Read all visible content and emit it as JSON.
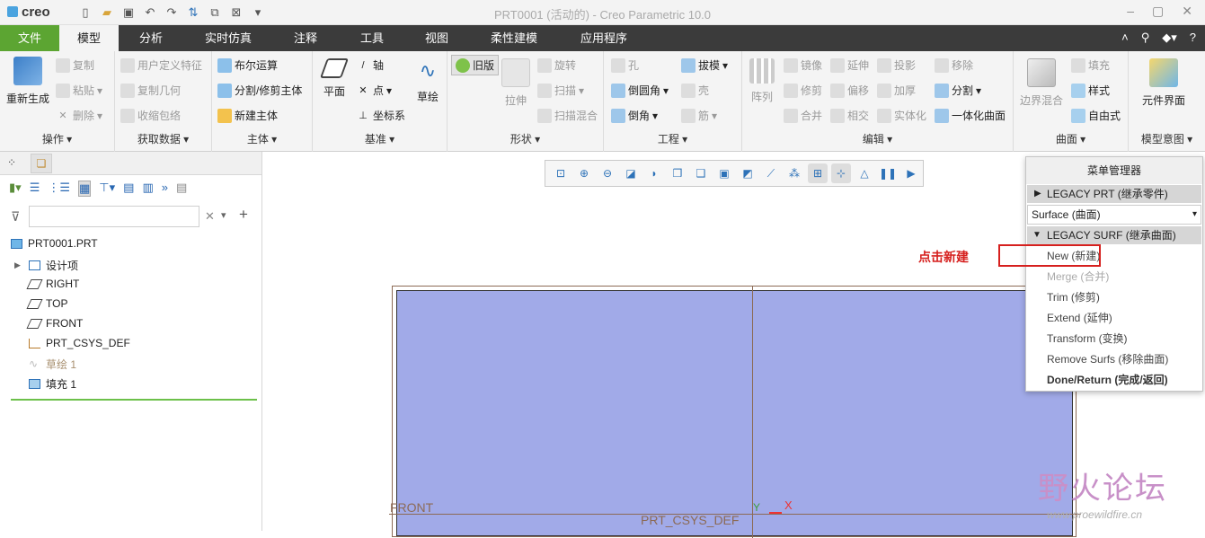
{
  "app": {
    "logo": "creo",
    "window_title": "PRT0001 (活动的) - Creo Parametric 10.0"
  },
  "tabs": {
    "file": "文件",
    "items": [
      "模型",
      "分析",
      "实时仿真",
      "注释",
      "工具",
      "视图",
      "柔性建模",
      "应用程序"
    ]
  },
  "ribbon": {
    "ops": {
      "regen": "重新生成",
      "copy": "复制",
      "paste": "粘贴",
      "delete": "删除",
      "name": "操作"
    },
    "getdata": {
      "udf": "用户定义特征",
      "copygeom": "复制几何",
      "shrinkwrap": "收缩包络",
      "name": "获取数据"
    },
    "body": {
      "boolean": "布尔运算",
      "split": "分割/修剪主体",
      "newbody": "新建主体",
      "name": "主体"
    },
    "datum": {
      "plane": "平面",
      "axis": "轴",
      "point": "点",
      "csys": "坐标系",
      "sketch": "草绘",
      "name": "基准"
    },
    "shapes": {
      "legacy": "旧版",
      "extrude": "拉伸",
      "revolve": "旋转",
      "sweep": "扫描",
      "sweepblend": "扫描混合",
      "name": "形状"
    },
    "eng": {
      "hole": "孔",
      "round": "倒圆角",
      "chamfer": "倒角",
      "draft": "拔模",
      "shell": "壳",
      "rib": "筋",
      "name": "工程"
    },
    "edit": {
      "pattern": "阵列",
      "mirror": "镜像",
      "trim": "修剪",
      "merge": "合并",
      "extend": "延伸",
      "offset": "偏移",
      "intersect": "相交",
      "project": "投影",
      "thicken": "加厚",
      "solidify": "实体化",
      "remove": "移除",
      "split": "分割",
      "unify": "一体化曲面",
      "name": "编辑"
    },
    "surfaces": {
      "boundary": "边界混合",
      "fill": "填充",
      "style": "样式",
      "freestyle": "自由式",
      "name": "曲面"
    },
    "intent": {
      "component": "元件界面",
      "name": "模型意图"
    }
  },
  "tree": {
    "root": "PRT0001.PRT",
    "items": [
      "设计项",
      "RIGHT",
      "TOP",
      "FRONT",
      "PRT_CSYS_DEF",
      "草绘 1",
      "填充 1"
    ]
  },
  "canvas": {
    "label_front": "FRONT",
    "label_csys": "PRT_CSYS_DEF",
    "axis_y": "Y",
    "axis_x": "X"
  },
  "menu_manager": {
    "title": "菜单管理器",
    "legacy_prt": "LEGACY PRT (继承零件)",
    "surface_select": "Surface (曲面)",
    "legacy_surf": "LEGACY SURF (继承曲面)",
    "options": [
      "New (新建)",
      "Merge (合并)",
      "Trim (修剪)",
      "Extend (延伸)",
      "Transform (变换)",
      "Remove Surfs (移除曲面)",
      "Done/Return (完成/返回)"
    ]
  },
  "annotation": "点击新建",
  "watermark": {
    "text": "野火论坛",
    "url": "www.proewildfire.cn"
  },
  "colors": {
    "file_tab": "#5ca532",
    "tabbar": "#3b3b3b",
    "surface_fill": "#a1aae8",
    "annotation": "#d6201e"
  }
}
